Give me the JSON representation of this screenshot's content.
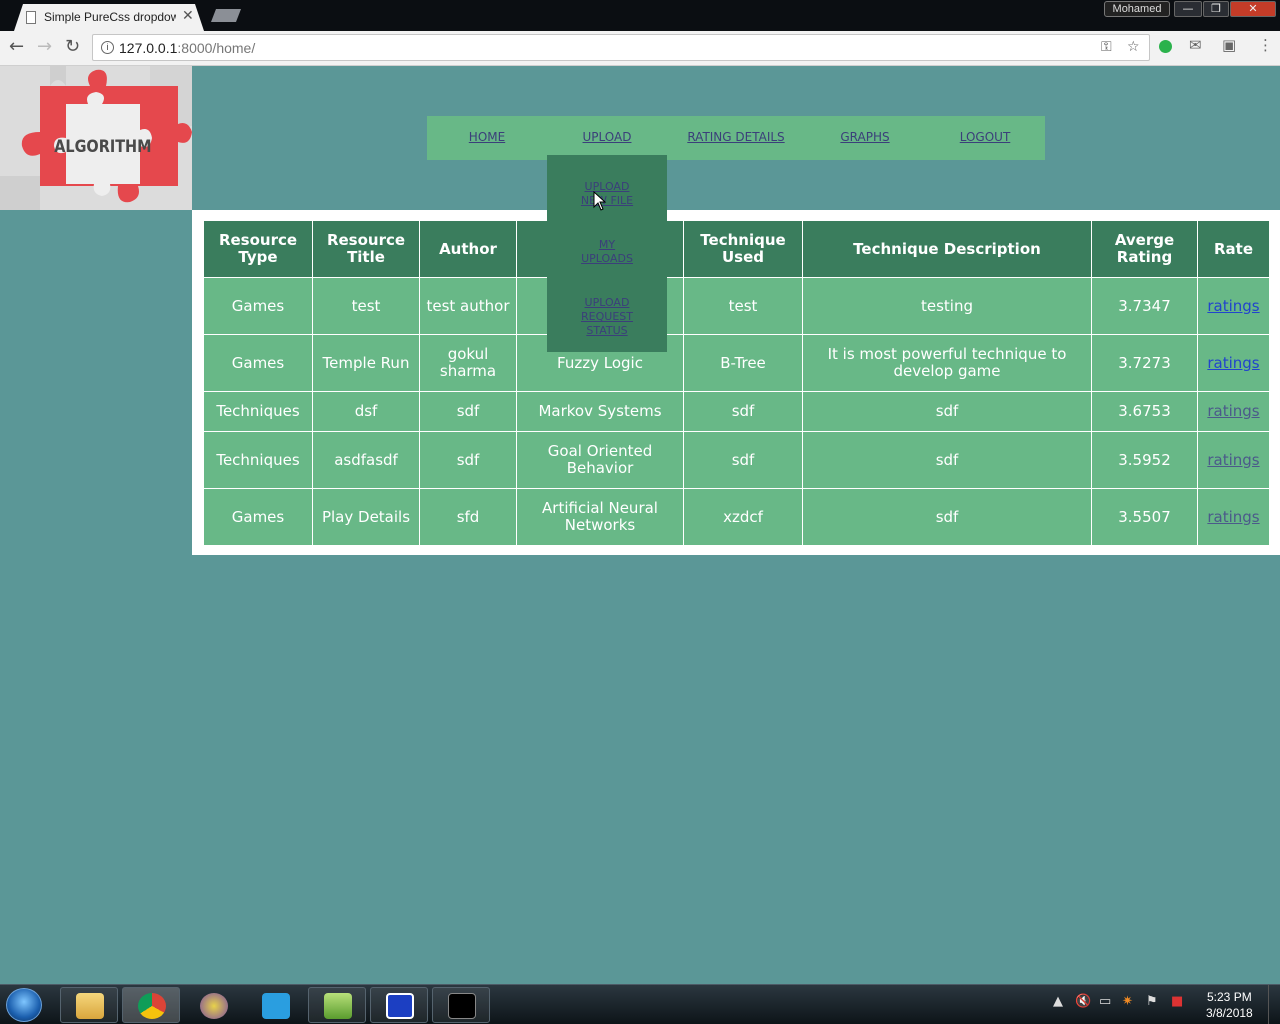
{
  "browser": {
    "tab_title": "Simple PureCss dropdown",
    "url_host": "127.0.0.1",
    "url_path": ":8000/home/",
    "user_label": "Mohamed",
    "minimize": "—",
    "maximize": "❐",
    "close": "✕",
    "tab_close": "✕"
  },
  "logo": {
    "text": "ALGORITHM"
  },
  "menu": {
    "items": [
      {
        "label": "HOME"
      },
      {
        "label": "UPLOAD"
      },
      {
        "label": "RATING DETAILS"
      },
      {
        "label": "GRAPHS"
      },
      {
        "label": "LOGOUT"
      }
    ],
    "upload_dropdown": [
      {
        "label": "UPLOAD NEW FILE"
      },
      {
        "label": "MY UPLOADS"
      },
      {
        "label": "UPLOAD REQUEST STATUS"
      }
    ]
  },
  "table": {
    "headers": [
      "Resource Type",
      "Resource Title",
      "Author",
      "",
      "Technique Used",
      "Technique Description",
      "Averge Rating",
      "Rate"
    ],
    "rows": [
      {
        "type": "Games",
        "title": "test",
        "author": "test author",
        "algorithm": "",
        "technique": "test",
        "description": "testing",
        "rating": "3.7347",
        "rate_link": "ratings"
      },
      {
        "type": "Games",
        "title": "Temple Run",
        "author": "gokul sharma",
        "algorithm": "Fuzzy Logic",
        "technique": "B-Tree",
        "description": "It is most powerful technique to develop game",
        "rating": "3.7273",
        "rate_link": "ratings"
      },
      {
        "type": "Techniques",
        "title": "dsf",
        "author": "sdf",
        "algorithm": "Markov Systems",
        "technique": "sdf",
        "description": "sdf",
        "rating": "3.6753",
        "rate_link": "ratings"
      },
      {
        "type": "Techniques",
        "title": "asdfasdf",
        "author": "sdf",
        "algorithm": "Goal Oriented Behavior",
        "technique": "sdf",
        "description": "sdf",
        "rating": "3.5952",
        "rate_link": "ratings"
      },
      {
        "type": "Games",
        "title": "Play Details",
        "author": "sfd",
        "algorithm": "Artificial Neural Networks",
        "technique": "xzdcf",
        "description": "sdf",
        "rating": "3.5507",
        "rate_link": "ratings"
      }
    ]
  },
  "taskbar": {
    "apps": [
      "file-explorer-icon",
      "chrome-icon",
      "eclipse-icon",
      "app-blue-icon",
      "notepad-plus-icon",
      "virtualbox-icon",
      "cmd-icon"
    ],
    "time": "5:23 PM",
    "date": "3/8/2018"
  },
  "colors": {
    "page_bg": "#5b9797",
    "menu_bg": "#68b887",
    "header_bg": "#3a7d5d",
    "cell_bg": "#68b887",
    "link": "#3b3f7a"
  }
}
